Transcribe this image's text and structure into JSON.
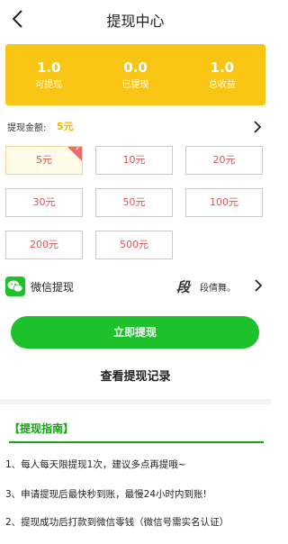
{
  "header": {
    "title": "提现中心"
  },
  "stats": [
    {
      "value": "1.0",
      "label": "可提现"
    },
    {
      "value": "0.0",
      "label": "已提现"
    },
    {
      "value": "1.0",
      "label": "总收益"
    }
  ],
  "amount": {
    "label": "提现金额:",
    "value": "5元"
  },
  "options": [
    "5元",
    "10元",
    "20元",
    "30元",
    "50元",
    "100元",
    "200元",
    "500元"
  ],
  "selected_option": "5元",
  "payment": {
    "method": "微信提现",
    "signature": "段",
    "user_name": "段倩舞。"
  },
  "withdraw_button": "立即提现",
  "records_link": "查看提现记录",
  "guide": {
    "title": "【提现指南】",
    "items": [
      "1、每人每天限提现1次，建议多点再提哦~",
      "3、申请提现后最快秒到账，最慢24小时内到账!",
      "2、提现成功后打款到微信零钱（微信号需实名认证）"
    ]
  },
  "colors": {
    "accent_yellow": "#f9c514",
    "wechat_green": "#1cc12b",
    "option_red": "#e05252",
    "guide_green": "#1aa11a"
  },
  "icons": {
    "back": "back-arrow-icon",
    "chevron": "chevron-right-icon",
    "wechat": "wechat-icon",
    "check": "check-icon"
  }
}
